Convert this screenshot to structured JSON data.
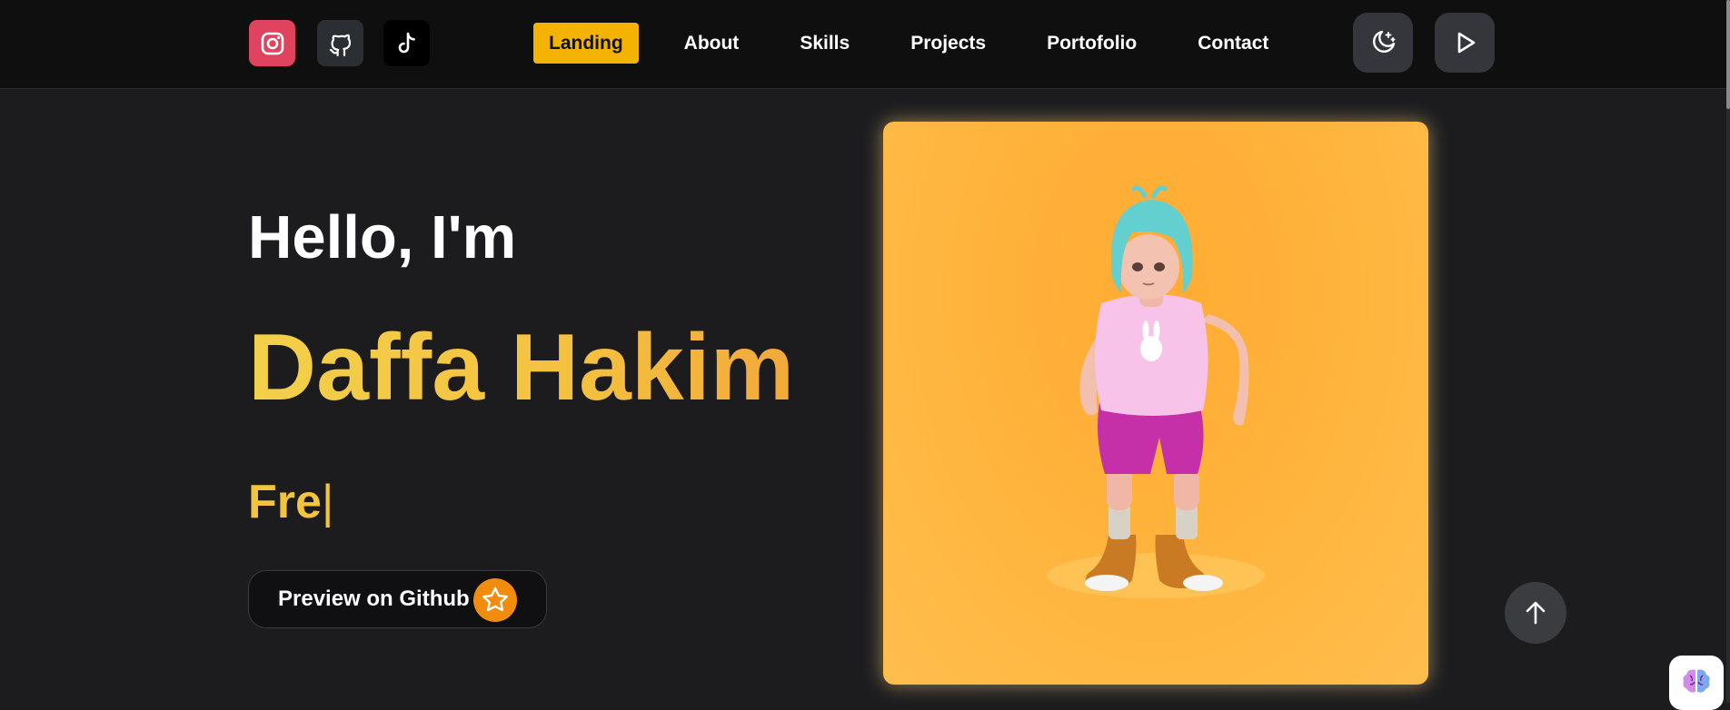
{
  "header": {
    "social": [
      {
        "name": "instagram-icon",
        "color": "#e0435d"
      },
      {
        "name": "github-icon",
        "color": "#2b2e33"
      },
      {
        "name": "tiktok-icon",
        "color": "#000000"
      }
    ],
    "nav": [
      {
        "label": "Landing",
        "active": true
      },
      {
        "label": "About",
        "active": false
      },
      {
        "label": "Skills",
        "active": false
      },
      {
        "label": "Projects",
        "active": false
      },
      {
        "label": "Portofolio",
        "active": false
      },
      {
        "label": "Contact",
        "active": false
      }
    ],
    "theme_toggle_icon": "moon-stars-icon",
    "play_icon": "play-icon"
  },
  "hero": {
    "greeting": "Hello, I'm",
    "name": "Daffa Hakim",
    "typed_text": "Fre",
    "caret": "|",
    "github_button_label": "Preview on Github",
    "github_button_icon": "star-icon"
  },
  "avatar": {
    "description_icon": "3d-avatar-girl",
    "background": "#ffb23a"
  },
  "floating": {
    "scroll_top_icon": "arrow-up-icon",
    "assistant_icon": "brain-icon"
  },
  "colors": {
    "accent": "#f5b301",
    "name_gradient_start": "#f3d04a",
    "name_gradient_end": "#f2a93b",
    "background": "#1c1c1f",
    "header_background": "#0f0f10"
  }
}
